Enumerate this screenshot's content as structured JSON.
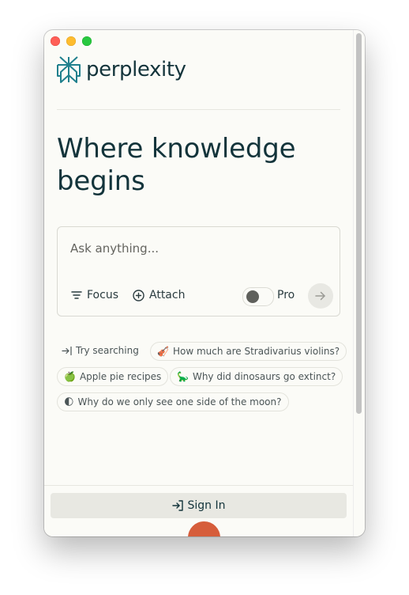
{
  "app": {
    "brand": "perplexity"
  },
  "hero": {
    "headline": "Where knowledge begins"
  },
  "search": {
    "placeholder": "Ask anything...",
    "focus_label": "Focus",
    "attach_label": "Attach",
    "pro_label": "Pro",
    "pro_enabled": false
  },
  "suggestions": {
    "try_label": "Try searching",
    "chips": [
      {
        "emoji": "🎻",
        "text": "How much are Stradivarius violins?"
      },
      {
        "emoji": "🍏",
        "text": "Apple pie recipes"
      },
      {
        "emoji": "🦕",
        "text": "Why did dinosaurs go extinct?"
      },
      {
        "emoji": "🌓",
        "text": "Why do we only see one side of the moon?"
      }
    ]
  },
  "footer": {
    "signin_label": "Sign In"
  },
  "icons": [
    "perplexity-logo-icon",
    "focus-icon",
    "attach-icon",
    "arrow-right-icon",
    "try-searching-icon",
    "sign-in-icon"
  ],
  "colors": {
    "brand_teal": "#20808D",
    "text_dark": "#13343b",
    "background": "#fbfbf7",
    "accent_orange": "#d65d3b"
  }
}
